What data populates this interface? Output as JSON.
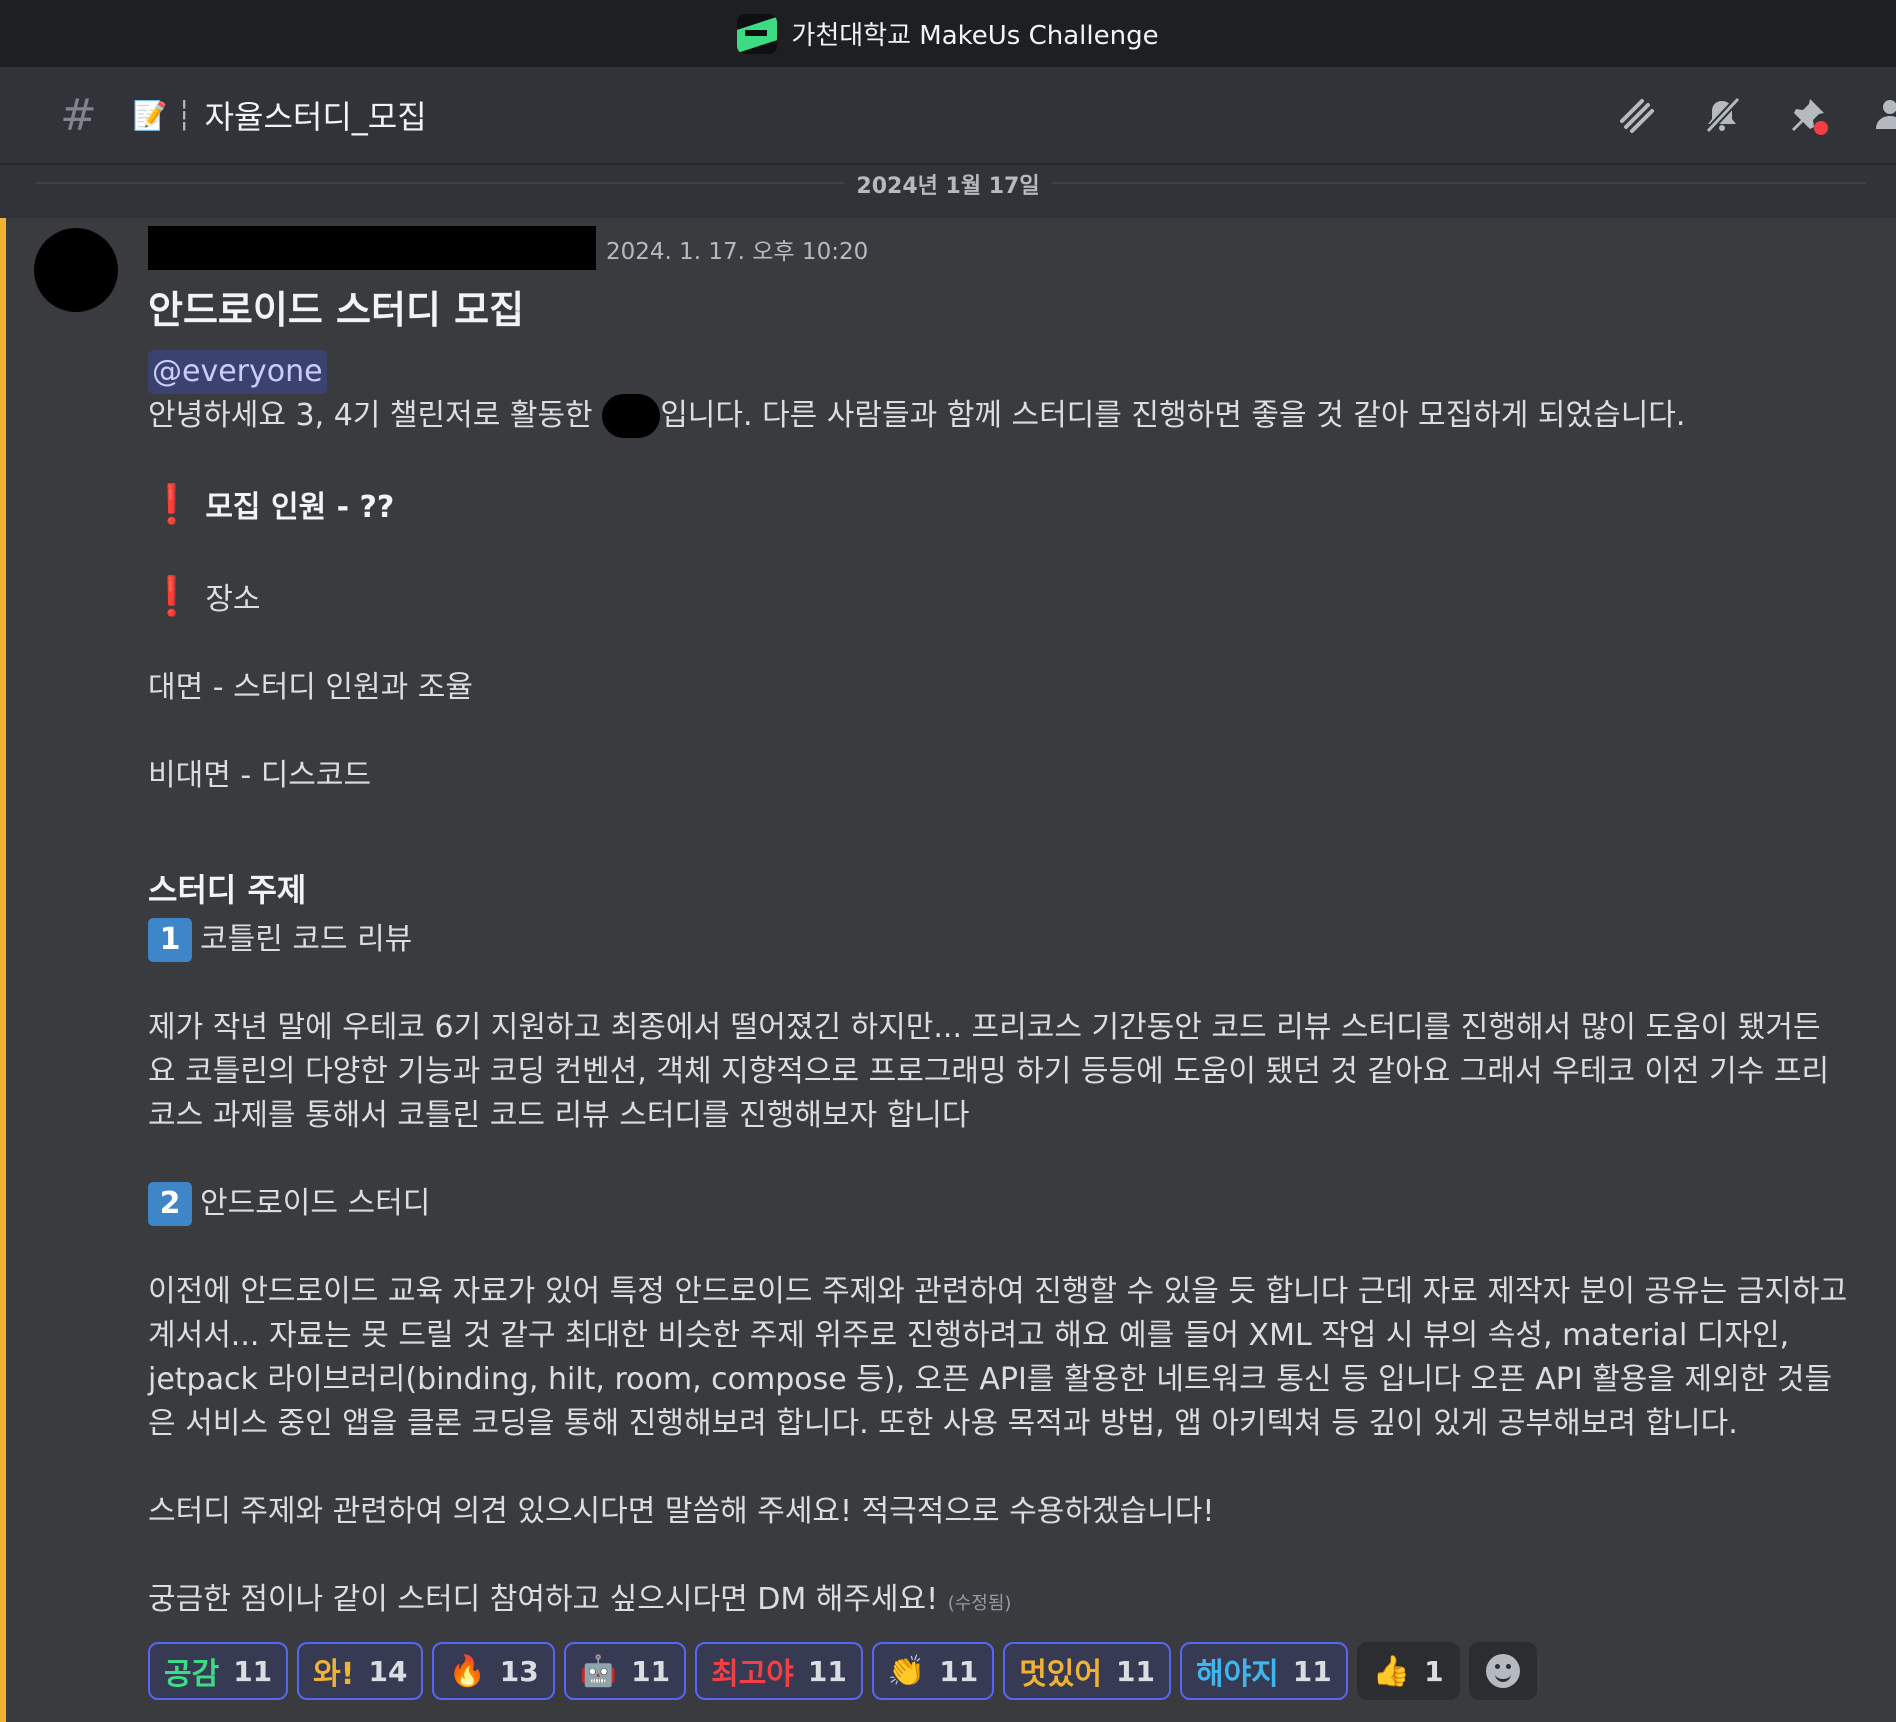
{
  "window": {
    "title": "가천대학교 MakeUs Challenge"
  },
  "channel": {
    "hash": "#",
    "memo": "📝",
    "separator": "┆",
    "name": "자율스터디_모집"
  },
  "toolbar": {
    "threads": "threads-icon",
    "mute": "bell-slash-icon",
    "pins": "pin-icon",
    "members": "members-icon"
  },
  "date_divider": "2024년 1월 17일",
  "message": {
    "timestamp": "2024. 1. 17. 오후 10:20",
    "heading": "안드로이드 스터디 모집",
    "mention": "@everyone",
    "intro_before": "안녕하세요 3, 4기 챌린저로 활동한 ",
    "intro_after": "입니다. 다른 사람들과 함께 스터디를 진행하면 좋을 것 같아 모집하게 되었습니다.",
    "exclaim_mark": "❗",
    "recruit": "모집 인원 - ??",
    "place": "장소",
    "offline": "대면 - 스터디 인원과 조율",
    "online": "비대면 - 디스코드",
    "topic_heading": "스터디 주제",
    "topic1_num": "1",
    "topic1_title": "코틀린 코드 리뷰",
    "topic1_body": "제가 작년 말에 우테코 6기 지원하고 최종에서 떨어졌긴 하지만... 프리코스 기간동안 코드 리뷰 스터디를 진행해서 많이 도움이 됐거든요 코틀린의 다양한 기능과 코딩 컨벤션, 객체 지향적으로 프로그래밍 하기 등등에 도움이 됐던 것 같아요 그래서 우테코 이전 기수 프리코스 과제를 통해서 코틀린 코드 리뷰 스터디를 진행해보자 합니다",
    "topic2_num": "2",
    "topic2_title": "안드로이드 스터디",
    "topic2_body": "이전에 안드로이드 교육 자료가 있어 특정 안드로이드 주제와 관련하여 진행할 수 있을 듯 합니다 근데 자료 제작자 분이 공유는 금지하고 계서서... 자료는 못 드릴 것 같구 최대한 비슷한 주제 위주로 진행하려고 해요 예를 들어 XML 작업 시 뷰의 속성, material 디자인, jetpack 라이브러리(binding, hilt, room, compose 등), 오픈 API를 활용한 네트워크 통신 등 입니다 오픈 API 활용을 제외한 것들은 서비스 중인 앱을 클론 코딩을 통해 진행해보려 합니다. 또한 사용 목적과 방법, 앱 아키텍쳐 등 깊이 있게 공부해보려 합니다.",
    "opinion": "스터디 주제와 관련하여 의견 있으시다면 말씀해 주세요! 적극적으로 수용하겠습니다!",
    "closing": "궁금한 점이나 같이 스터디 참여하고 싶으시다면 DM 해주세요!",
    "edited": "(수정됨)"
  },
  "reactions": [
    {
      "emoji": "공감",
      "count": "11",
      "color": "#3ddc84"
    },
    {
      "emoji": "와!",
      "count": "14",
      "color": "#f0b232"
    },
    {
      "emoji": "🔥",
      "count": "13",
      "color": "#ff7a1a"
    },
    {
      "emoji": "🤖",
      "count": "11",
      "color": "#3ddc84"
    },
    {
      "emoji": "최고야",
      "count": "11",
      "color": "#f23f43"
    },
    {
      "emoji": "👏",
      "count": "11",
      "color": "#c8a06a"
    },
    {
      "emoji": "멋있어",
      "count": "11",
      "color": "#f0b232"
    },
    {
      "emoji": "해야지",
      "count": "11",
      "color": "#3fb6f0"
    },
    {
      "emoji": "👍",
      "count": "1",
      "color": "#f0b232"
    }
  ],
  "add_reaction": "smile-plus-icon"
}
